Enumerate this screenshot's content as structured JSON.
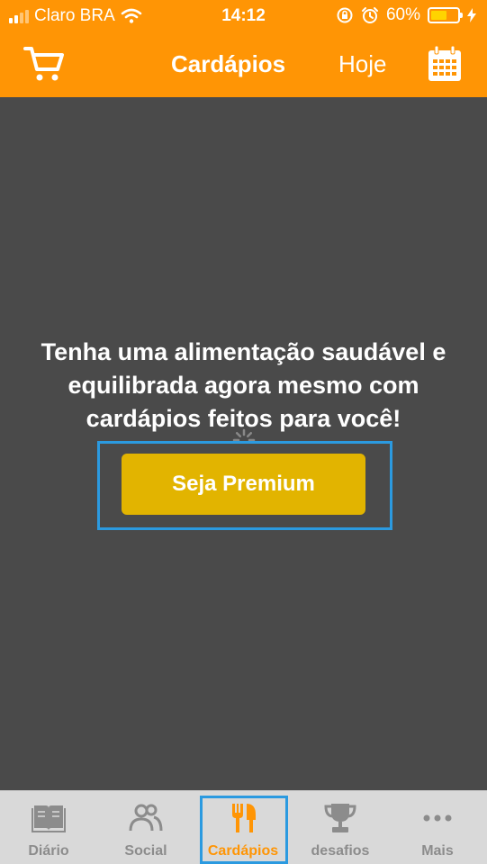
{
  "status_bar": {
    "carrier": "Claro BRA",
    "time": "14:12",
    "battery_percent": "60%",
    "battery_level": 0.6,
    "icons": [
      "signal-icon",
      "wifi-icon",
      "rotation-lock-icon",
      "alarm-icon",
      "battery-icon",
      "charging-icon"
    ]
  },
  "nav": {
    "title": "Cardápios",
    "today_label": "Hoje",
    "cart_icon": "cart-icon",
    "calendar_icon": "calendar-icon"
  },
  "main": {
    "promo_text": "Tenha uma alimentação saudável e equilibrada agora mesmo com cardápios feitos para você!",
    "premium_button": "Seja Premium"
  },
  "tabs": [
    {
      "label": "Diário",
      "icon": "book-icon",
      "active": false
    },
    {
      "label": "Social",
      "icon": "people-icon",
      "active": false
    },
    {
      "label": "Cardápios",
      "icon": "cutlery-icon",
      "active": true
    },
    {
      "label": "desafios",
      "icon": "trophy-icon",
      "active": false
    },
    {
      "label": "Mais",
      "icon": "more-dots-icon",
      "active": false
    }
  ],
  "colors": {
    "accent": "#ff9505",
    "premium_button": "#e2b400",
    "background": "#4a4a4a",
    "tab_bar": "#d9d9d9",
    "highlight": "#2b9ae0"
  }
}
